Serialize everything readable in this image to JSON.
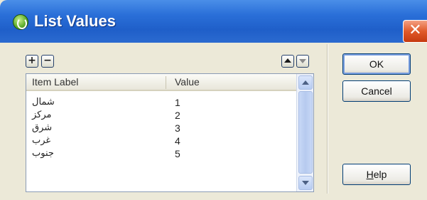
{
  "window": {
    "title": "List Values",
    "close_glyph": "✕"
  },
  "toolbar": {
    "add_glyph": "+",
    "remove_glyph": "−"
  },
  "list": {
    "columns": [
      "Item Label",
      "Value"
    ],
    "rows": [
      {
        "label": "شمال",
        "value": "1"
      },
      {
        "label": "مرکز",
        "value": "2"
      },
      {
        "label": "شرق",
        "value": "3"
      },
      {
        "label": "غرب",
        "value": "4"
      },
      {
        "label": "جنوب",
        "value": "5"
      }
    ]
  },
  "buttons": {
    "ok": "OK",
    "cancel": "Cancel",
    "help_underlined": "H",
    "help_rest": "elp"
  },
  "colors": {
    "titlebar": "#2a6fd8",
    "close": "#e05a2a",
    "background": "#ece9d8"
  }
}
